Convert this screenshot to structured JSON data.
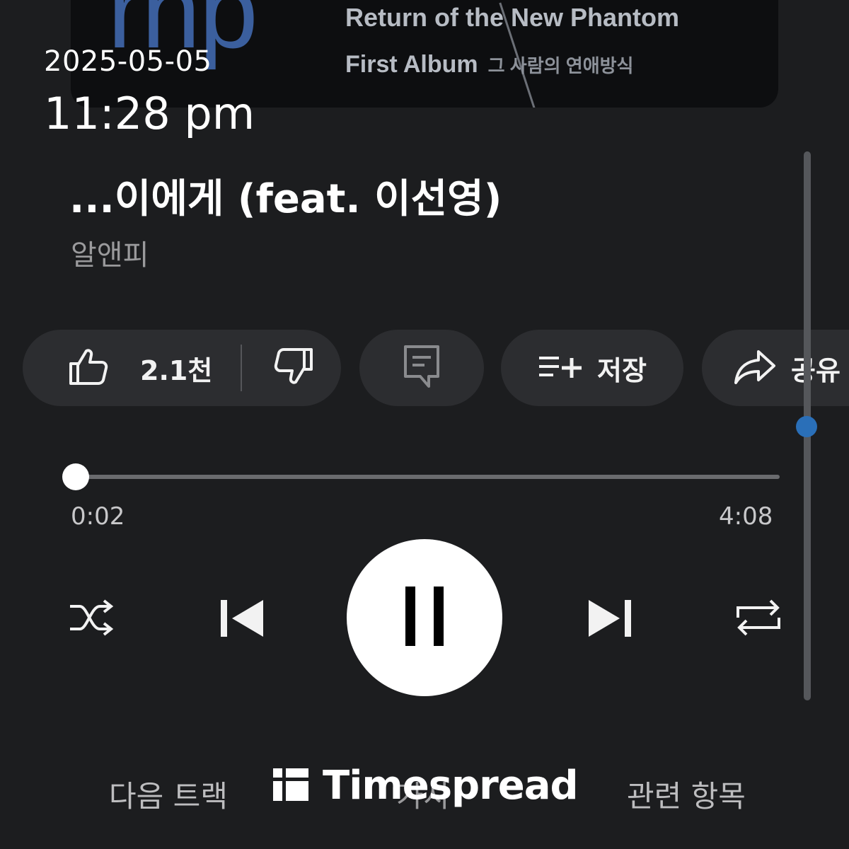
{
  "album_art": {
    "logo_text": "rnp",
    "line1": "Return of the New Phantom",
    "line2": "First Album",
    "line2_korean": "그 사람의 연애방식"
  },
  "timestamp": {
    "date": "2025-05-05",
    "time": "11:28 pm"
  },
  "song": {
    "title": "...이에게 (feat. 이선영)",
    "artist": "알앤피"
  },
  "actions": {
    "like_count": "2.1천",
    "save_label": "저장",
    "share_label": "공유"
  },
  "progress": {
    "elapsed": "0:02",
    "total": "4:08",
    "fraction": 0.008
  },
  "tabs": {
    "next_track": "다음 트랙",
    "lyrics": "가사",
    "related": "관련 항목"
  },
  "watermark": {
    "text": "Timespread"
  },
  "colors": {
    "background": "#1c1d1f",
    "chip": "#2c2d30",
    "scroll_thumb": "#2a6fb8",
    "artist_text": "#9a9a9c"
  },
  "icons": {
    "like": "thumbs-up-icon",
    "dislike": "thumbs-down-icon",
    "comment": "comment-icon",
    "save": "playlist-add-icon",
    "share": "share-arrow-icon",
    "shuffle": "shuffle-icon",
    "previous": "skip-previous-icon",
    "pause": "pause-icon",
    "next": "skip-next-icon",
    "repeat": "repeat-icon"
  }
}
